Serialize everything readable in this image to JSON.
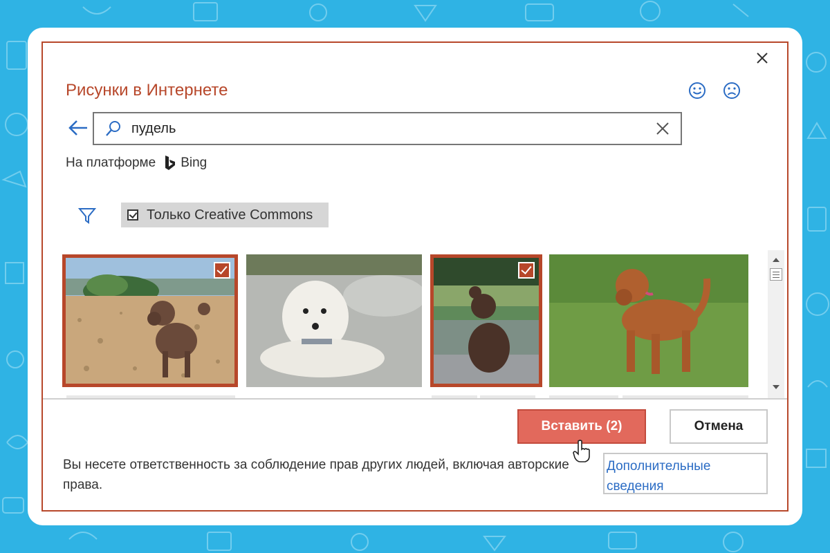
{
  "dialog": {
    "title": "Рисунки в Интернете",
    "accent_color": "#b7472a",
    "background_color": "#2fb3e4"
  },
  "feedback": {
    "smile_icon": "smile-icon",
    "frown_icon": "frown-icon"
  },
  "search": {
    "value": "пудель",
    "icon": "search-icon",
    "clear_icon": "close-icon"
  },
  "source": {
    "label": "На платформе",
    "provider": "Bing"
  },
  "filter": {
    "icon": "funnel-icon",
    "creative_commons_label": "Только Creative Commons",
    "creative_commons_checked": true
  },
  "results": [
    {
      "subject": "brown poodle on pebble beach",
      "selected": true
    },
    {
      "subject": "white poodle lying on pavement",
      "selected": false
    },
    {
      "subject": "brown poodle sitting on boat deck",
      "selected": true
    },
    {
      "subject": "red poodle standing on grass",
      "selected": false
    }
  ],
  "actions": {
    "insert_label": "Вставить (2)",
    "cancel_label": "Отмена"
  },
  "footer": {
    "disclaimer": "Вы несете ответственность за соблюдение прав других людей, включая авторские права.",
    "more_info_link": "Дополнительные сведения"
  }
}
